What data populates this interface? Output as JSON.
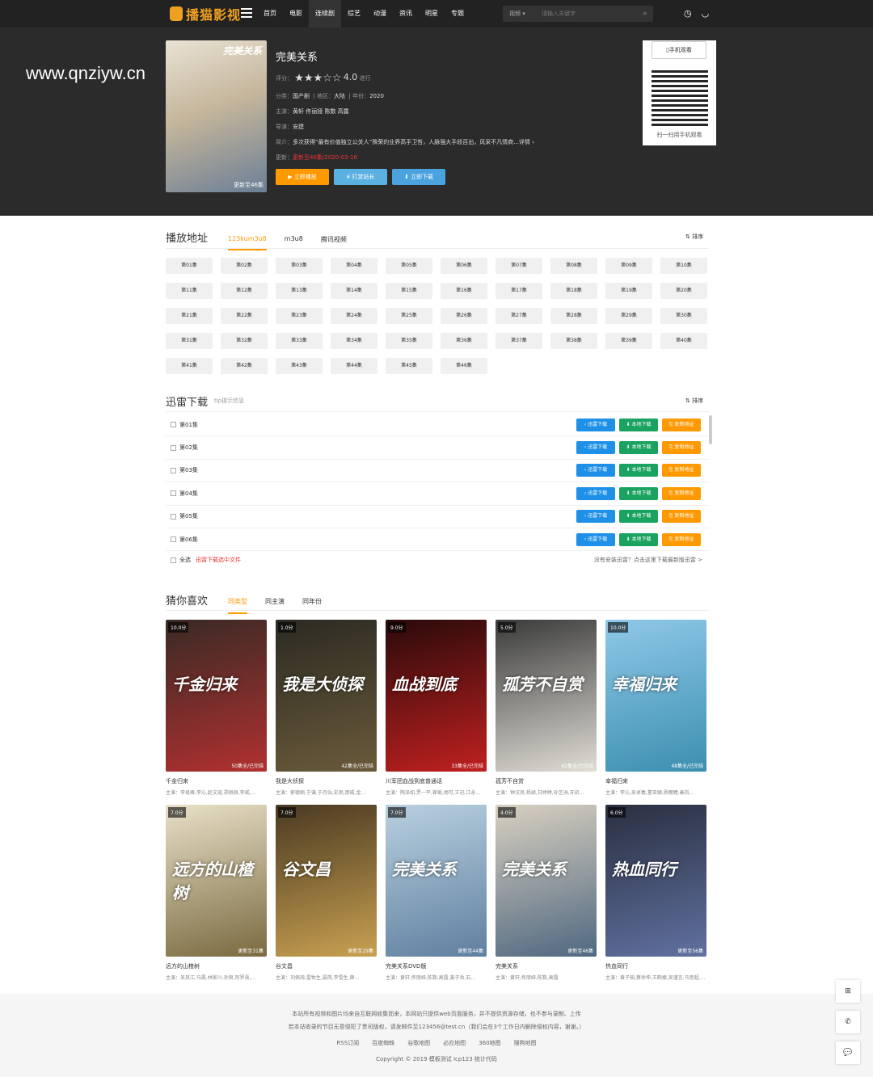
{
  "site": {
    "logo_text": "播猫影视",
    "watermark": "www.qnziyw.cn"
  },
  "nav": [
    {
      "label": "首页"
    },
    {
      "label": "电影"
    },
    {
      "label": "连续剧",
      "active": true
    },
    {
      "label": "综艺"
    },
    {
      "label": "动漫"
    },
    {
      "label": "资讯"
    },
    {
      "label": "明星"
    },
    {
      "label": "专题"
    }
  ],
  "search": {
    "category": "视频 ▾",
    "placeholder": "请输入关键字"
  },
  "detail": {
    "title": "完美关系",
    "poster_title": "完美关系",
    "poster_tag": "更新至46集",
    "rating_label": "评分：",
    "stars": "★★★☆☆",
    "score": "4.0",
    "score_suffix": "进行",
    "category_label": "分类：",
    "category": "国产剧",
    "region_label": "地区：",
    "region": "大陆",
    "year_label": "年份：",
    "year": "2020",
    "cast_label": "主演：",
    "cast": "黄轩 佟丽娅 陈数 高露",
    "director_label": "导演：",
    "director": "安建",
    "summary_label": "简介：",
    "summary": "多次获得“最有价值独立公关人”殊荣的业界高手卫哲，人脉强大手段百出，风采不凡情商...详情 ›",
    "update_label": "更新：",
    "update": "更新至46集/2020-03-16",
    "btn_play": "▶ 立即播放",
    "btn_reward": "¥ 打赏站长",
    "btn_download": "⬇ 立即下载"
  },
  "qr": {
    "btn": "▯手机观看",
    "caption": "扫一扫用手机观看"
  },
  "play": {
    "title": "播放地址",
    "tabs": [
      "123kum3u8",
      "m3u8",
      "腾讯视频"
    ],
    "sort": "⇅ 排序",
    "episodes": [
      "第01集",
      "第02集",
      "第03集",
      "第04集",
      "第05集",
      "第06集",
      "第07集",
      "第08集",
      "第09集",
      "第10集",
      "第11集",
      "第12集",
      "第13集",
      "第14集",
      "第15集",
      "第16集",
      "第17集",
      "第18集",
      "第19集",
      "第20集",
      "第21集",
      "第22集",
      "第23集",
      "第24集",
      "第25集",
      "第26集",
      "第27集",
      "第28集",
      "第29集",
      "第30集",
      "第31集",
      "第32集",
      "第33集",
      "第34集",
      "第35集",
      "第36集",
      "第37集",
      "第38集",
      "第39集",
      "第40集",
      "第41集",
      "第42集",
      "第43集",
      "第44集",
      "第45集",
      "第46集"
    ]
  },
  "download": {
    "title": "迅雷下载",
    "tip": "tip提示信息",
    "sort": "⇅ 排序",
    "rows": [
      "第01集",
      "第02集",
      "第03集",
      "第04集",
      "第05集",
      "第06集"
    ],
    "btn_xunlei": "‹ 迅雷下载",
    "btn_local": "⬇ 本地下载",
    "btn_copy": "⎘ 复制地址",
    "select_all": "全选",
    "select_tip": "迅雷下载选中文件",
    "hint": "没有安装迅雷？点击这里下载最新版迅雷 >"
  },
  "recommend": {
    "title": "猜你喜欢",
    "tabs": [
      "同类型",
      "同主演",
      "同年份"
    ],
    "movies": [
      {
        "rate": "10.0分",
        "status": "50集全/已完结",
        "name": "千金归来",
        "cast": "主演：李易峰,李沁,赵文瑄,郑佩佩,李威,...",
        "cover": "千金归来",
        "c1": "#3a2a25",
        "c2": "#b03030"
      },
      {
        "rate": "1.0分",
        "status": "42集全/已完结",
        "name": "我是大侦探",
        "cast": "主演：郭德纲,于谦,于月仙,史珉,那威,金...",
        "cover": "我是大侦探",
        "c1": "#2b2a22",
        "c2": "#6a5a3a"
      },
      {
        "rate": "9.0分",
        "status": "33集全/已完结",
        "name": "川军团血战到底普通话",
        "cast": "主演：陶泽如,贾一平,崔岷,胡可,王迅,江永...",
        "cover": "血战到底",
        "c1": "#2a0a0a",
        "c2": "#c02020"
      },
      {
        "rate": "5.0分",
        "status": "62集全/已完结",
        "name": "孤芳不自赏",
        "cast": "主演：钟汉良,杨颖,甘婷婷,孙艺洲,牙凯...",
        "cover": "孤芳不自赏",
        "c1": "#3a3a3a",
        "c2": "#e0ddd5"
      },
      {
        "rate": "10.0分",
        "status": "48集全/已完结",
        "name": "幸福归来",
        "cast": "主演：李沁,吴卓羲,董亚嫄,杨爾睫,秦岚...",
        "cover": "幸福归来",
        "c1": "#8fc8e8",
        "c2": "#3c8fb0"
      },
      {
        "rate": "7.0分",
        "status": "更新至31集",
        "name": "远方的山楂树",
        "cast": "主演：吴其江,马晨,林家川,孙爽,阿罗熹,...",
        "cover": "远方的山楂树",
        "c1": "#e8e0c8",
        "c2": "#7a6a40"
      },
      {
        "rate": "7.0分",
        "status": "更新至29集",
        "name": "谷文昌",
        "cast": "主演：刘佩琦,雷牧生,聂简,李雪生,薛...",
        "cover": "谷文昌",
        "c1": "#4a3a22",
        "c2": "#c8a050"
      },
      {
        "rate": "7.0分",
        "status": "更新至44集",
        "name": "完美关系DVD版",
        "cast": "主演：黄轩,佟丽娅,陈数,高露,姜子岳,石...",
        "cover": "完美关系",
        "c1": "#b8d0e0",
        "c2": "#6080a0"
      },
      {
        "rate": "4.0分",
        "status": "更新至46集",
        "name": "完美关系",
        "cast": "主演：黄轩,佟丽娅,陈数,高露",
        "cover": "完美关系",
        "c1": "#d8d0c0",
        "c2": "#506880"
      },
      {
        "rate": "6.0分",
        "status": "更新至56集",
        "name": "热血同行",
        "cast": "主演：黄子韬,蔡徐坤,王鹤棣,吴谨言,马思超,...",
        "cover": "热血同行",
        "c1": "#2a3040",
        "c2": "#6070a0"
      }
    ]
  },
  "footer": {
    "line1": "本站所有视频和图片均来自互联网收集而来，本网站只提供web页面服务，并不提供资源存储，也不参与录制、上传",
    "line2": "若本站收录的节目无意侵犯了贵司版权，请发邮件至123456@test.cn（我们会在3个工作日内删除侵权内容，谢谢。）",
    "links": [
      "RSS订阅",
      "百度蜘蛛",
      "谷歌地图",
      "必应地图",
      "360地图",
      "搜狗地图"
    ],
    "copyright": "Copyright © 2019 模板测试 Icp123 统计代码"
  },
  "side": [
    "⊞",
    "✆",
    "💬"
  ]
}
